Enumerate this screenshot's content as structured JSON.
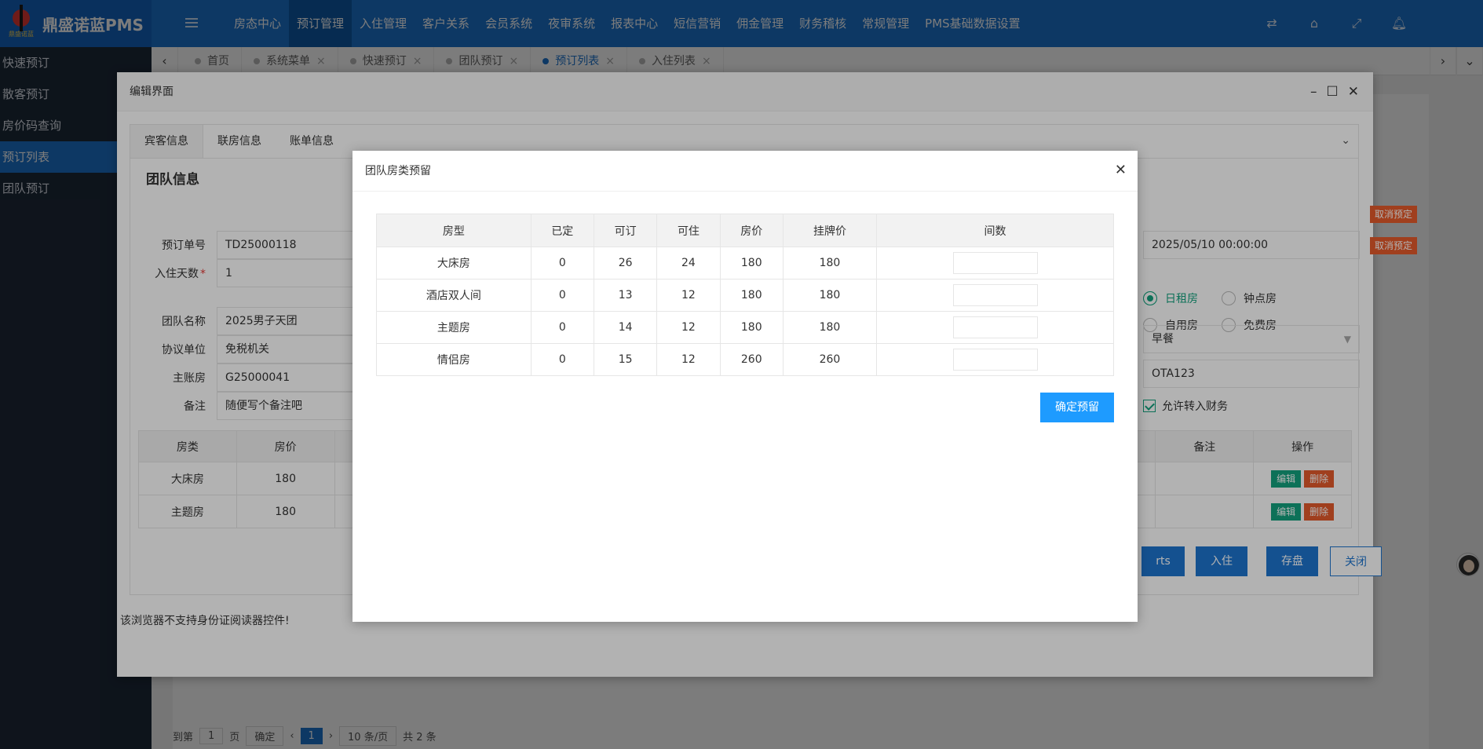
{
  "app": {
    "name": "鼎盛诺蓝PMS",
    "logo_text": "鼎盛诺蓝"
  },
  "top_menu": [
    "房态中心",
    "预订管理",
    "入住管理",
    "客户关系",
    "会员系统",
    "夜审系统",
    "报表中心",
    "短信营销",
    "佣金管理",
    "财务稽核",
    "常规管理",
    "PMS基础数据设置"
  ],
  "top_menu_active": 1,
  "top_icons": [
    "swap-icon",
    "home-icon",
    "fullscreen-icon",
    "bell-icon"
  ],
  "sidebar": [
    "快速预订",
    "散客预订",
    "房价码查询",
    "预订列表",
    "团队预订"
  ],
  "sidebar_active": 3,
  "tabs": [
    "首页",
    "系统菜单",
    "快速预订",
    "团队预订",
    "预订列表",
    "入住列表"
  ],
  "tabs_active": 4,
  "pager": {
    "goto": "到第",
    "page_value": "1",
    "page_unit": "页",
    "confirm": "确定",
    "current": "1",
    "size": "10 条/页",
    "total": "共 2 条"
  },
  "edit_dialog": {
    "title": "编辑界面",
    "tabs": [
      "宾客信息",
      "联房信息",
      "账单信息"
    ],
    "section_title": "团队信息",
    "fields": [
      {
        "label": "预订单号",
        "value": "TD25000118",
        "required": false
      },
      {
        "label": "入住天数",
        "value": "1",
        "required": true
      },
      {
        "label": "团队名称",
        "value": "2025男子天团",
        "required": false
      },
      {
        "label": "协议单位",
        "value": "免税机关",
        "required": false
      },
      {
        "label": "主账房",
        "value": "G25000041",
        "required": false
      },
      {
        "label": "备注",
        "value": "随便写个备注吧",
        "required": false
      }
    ],
    "right": {
      "datetime": "2025/05/10 00:00:00",
      "radios": [
        "日租房",
        "钟点房",
        "自用房",
        "免费房"
      ],
      "radio_selected": 0,
      "meal": "早餐",
      "channel": "OTA123",
      "allow_finance": "允许转入财务"
    },
    "side_cancel": "取消预定",
    "rooms_headers": [
      "房类",
      "房价",
      "备注",
      "操作"
    ],
    "rooms": [
      {
        "type": "大床房",
        "price": "180"
      },
      {
        "type": "主题房",
        "price": "180"
      }
    ],
    "row_edit": "编辑",
    "row_delete": "删除",
    "buttons": {
      "partial": "rts",
      "checkin": "入住",
      "save": "存盘",
      "close": "关闭"
    },
    "note": "该浏览器不支持身份证阅读器控件!"
  },
  "group_dialog": {
    "title": "团队房类预留",
    "headers": [
      "房型",
      "已定",
      "可订",
      "可住",
      "房价",
      "挂牌价",
      "间数"
    ],
    "rows": [
      [
        "大床房",
        "0",
        "26",
        "24",
        "180",
        "180"
      ],
      [
        "酒店双人间",
        "0",
        "13",
        "12",
        "180",
        "180"
      ],
      [
        "主题房",
        "0",
        "14",
        "12",
        "180",
        "180"
      ],
      [
        "情侣房",
        "0",
        "15",
        "12",
        "260",
        "260"
      ]
    ],
    "confirm": "确定预留"
  }
}
